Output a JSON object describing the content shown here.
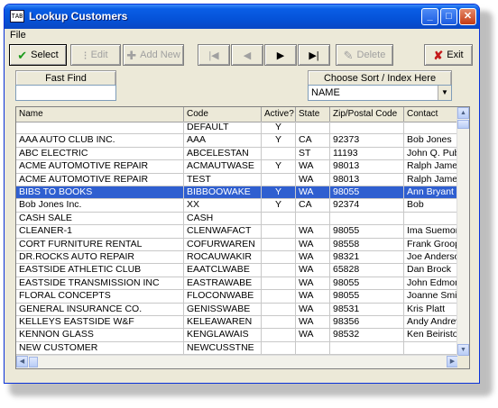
{
  "window": {
    "title": "Lookup Customers",
    "app_icon_text": "TAB"
  },
  "titlebar_buttons": {
    "minimize": "_",
    "maximize": "□",
    "close": "✕"
  },
  "menu": {
    "file": "File"
  },
  "toolbar": {
    "select": "Select",
    "edit": "Edit",
    "add_new": "Add New",
    "first": "|◀",
    "prev": "◀",
    "next": "▶",
    "last": "▶|",
    "delete": "Delete",
    "exit": "Exit",
    "select_icon": "check-icon",
    "exit_icon": "x-icon"
  },
  "fast_find": {
    "label": "Fast Find",
    "value": ""
  },
  "sort": {
    "label": "Choose Sort / Index Here",
    "selected": "NAME"
  },
  "table": {
    "columns": [
      "Name",
      "Code",
      "Active?",
      "State",
      "Zip/Postal Code",
      "Contact"
    ],
    "rows": [
      [
        "",
        "DEFAULT",
        "Y",
        "",
        "",
        ""
      ],
      [
        "AAA AUTO CLUB INC.",
        "AAA",
        "Y",
        "CA",
        "92373",
        "Bob Jones"
      ],
      [
        "ABC ELECTRIC",
        "ABCELESTAN",
        "",
        "ST",
        "11193",
        "John Q. Pub"
      ],
      [
        "ACME AUTOMOTIVE REPAIR",
        "ACMAUTWASE",
        "Y",
        "WA",
        "98013",
        "Ralph James"
      ],
      [
        "ACME AUTOMOTIVE REPAIR",
        "TEST",
        "",
        "WA",
        "98013",
        "Ralph James"
      ],
      [
        "BIBS TO BOOKS",
        "BIBBOOWAKE",
        "Y",
        "WA",
        "98055",
        "Ann Bryant"
      ],
      [
        "Bob Jones Inc.",
        "XX",
        "Y",
        "CA",
        "92374",
        "Bob"
      ],
      [
        "CASH SALE",
        "CASH",
        "",
        "",
        "",
        ""
      ],
      [
        "CLEANER-1",
        "CLENWAFACT",
        "",
        "WA",
        "98055",
        "Ima Suemor"
      ],
      [
        "CORT FURNITURE RENTAL",
        "COFURWAREN",
        "",
        "WA",
        "98558",
        "Frank Groop"
      ],
      [
        "DR.ROCKS AUTO REPAIR",
        "ROCAUWAKIR",
        "",
        "WA",
        "98321",
        "Joe Anderso"
      ],
      [
        "EASTSIDE ATHLETIC CLUB",
        "EAATCLWABE",
        "",
        "WA",
        "65828",
        "Dan Brock"
      ],
      [
        "EASTSIDE TRANSMISSION INC",
        "EASTRAWABE",
        "",
        "WA",
        "98055",
        "John Edmon"
      ],
      [
        "FLORAL CONCEPTS",
        "FLOCONWABE",
        "",
        "WA",
        "98055",
        "Joanne Smit"
      ],
      [
        "GENERAL INSURANCE CO.",
        "GENISSWABE",
        "",
        "WA",
        "98531",
        "Kris Platt"
      ],
      [
        "KELLEYS EASTSIDE W&F",
        "KELEAWAREN",
        "",
        "WA",
        "98356",
        "Andy Andrev"
      ],
      [
        "KENNON GLASS",
        "KENGLAWAIS",
        "",
        "WA",
        "98532",
        "Ken Beiristo"
      ],
      [
        "NEW CUSTOMER",
        "NEWCUSSTNE",
        "",
        "",
        "",
        ""
      ]
    ],
    "selected_row": 5
  },
  "scroll": {
    "up": "▲",
    "down": "▼",
    "left": "◀",
    "right": "▶"
  },
  "colors": {
    "title_bar": "#0552d8",
    "selection": "#2f5fd0"
  }
}
